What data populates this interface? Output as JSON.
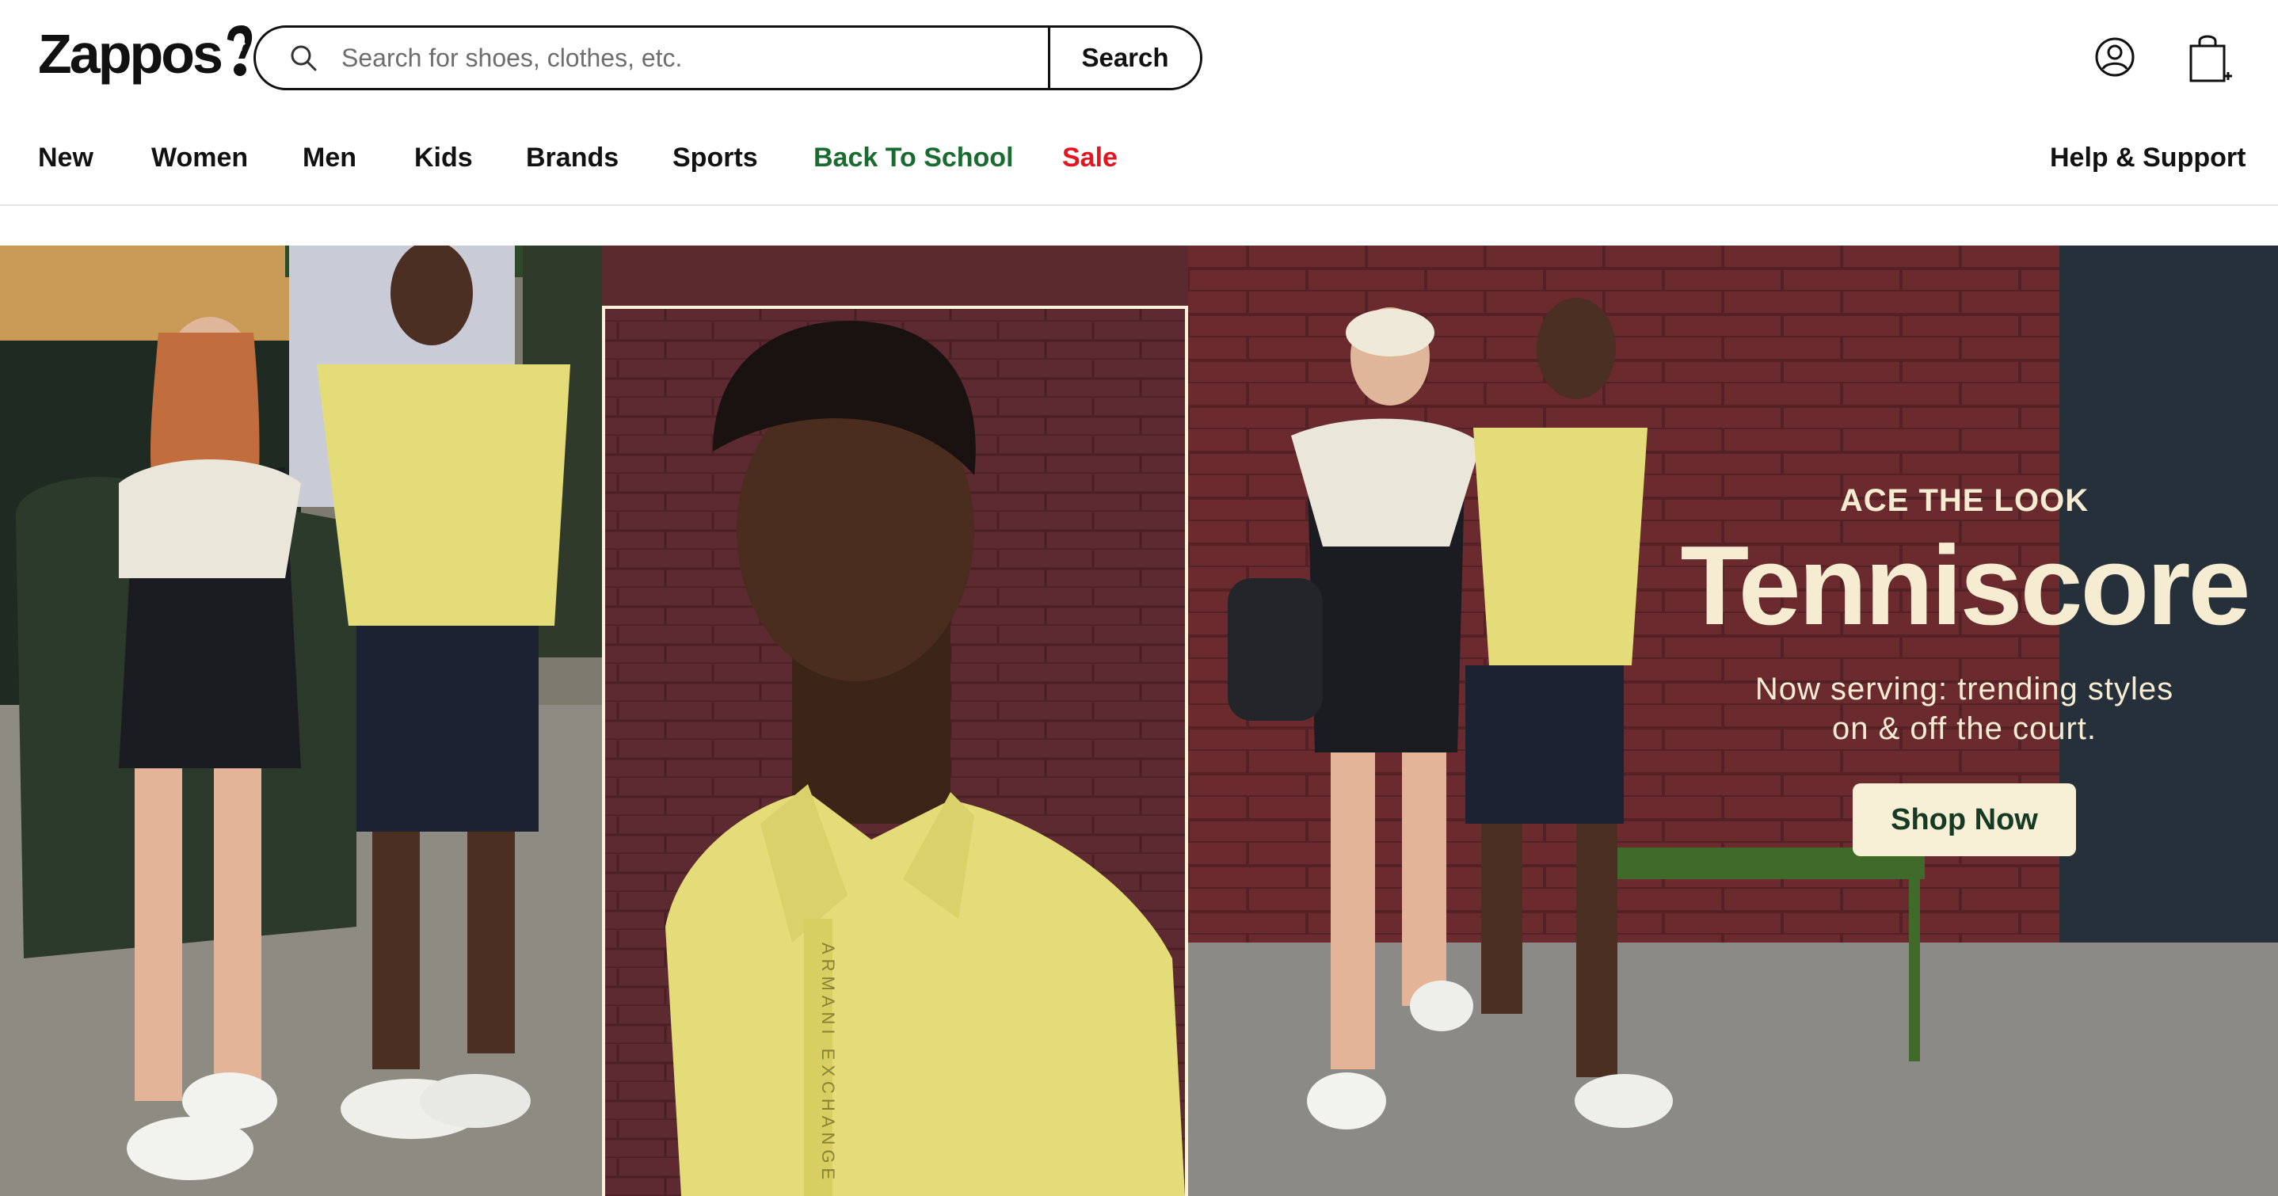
{
  "brand": {
    "name": "Zappos"
  },
  "search": {
    "placeholder": "Search for shoes, clothes, etc.",
    "value": "",
    "button_label": "Search"
  },
  "header_icons": {
    "account": "account-icon",
    "cart": "shopping-bag-icon"
  },
  "nav": {
    "items": [
      {
        "label": "New"
      },
      {
        "label": "Women"
      },
      {
        "label": "Men"
      },
      {
        "label": "Kids"
      },
      {
        "label": "Brands"
      },
      {
        "label": "Sports"
      },
      {
        "label": "Back To School",
        "color": "#1a6b30"
      },
      {
        "label": "Sale",
        "color": "#e3151f"
      }
    ],
    "help_label": "Help & Support"
  },
  "hero": {
    "eyebrow": "ACE THE LOOK",
    "title": "Tenniscore",
    "subtitle": "Now serving: trending styles on & off the court.",
    "cta_label": "Shop Now",
    "product_text": "ARMANI EXCHANGE",
    "colors": {
      "brick": "#5c2a30",
      "polo": "#e3dc78",
      "text": "#f6ecd2",
      "cta_text": "#163a23"
    }
  }
}
